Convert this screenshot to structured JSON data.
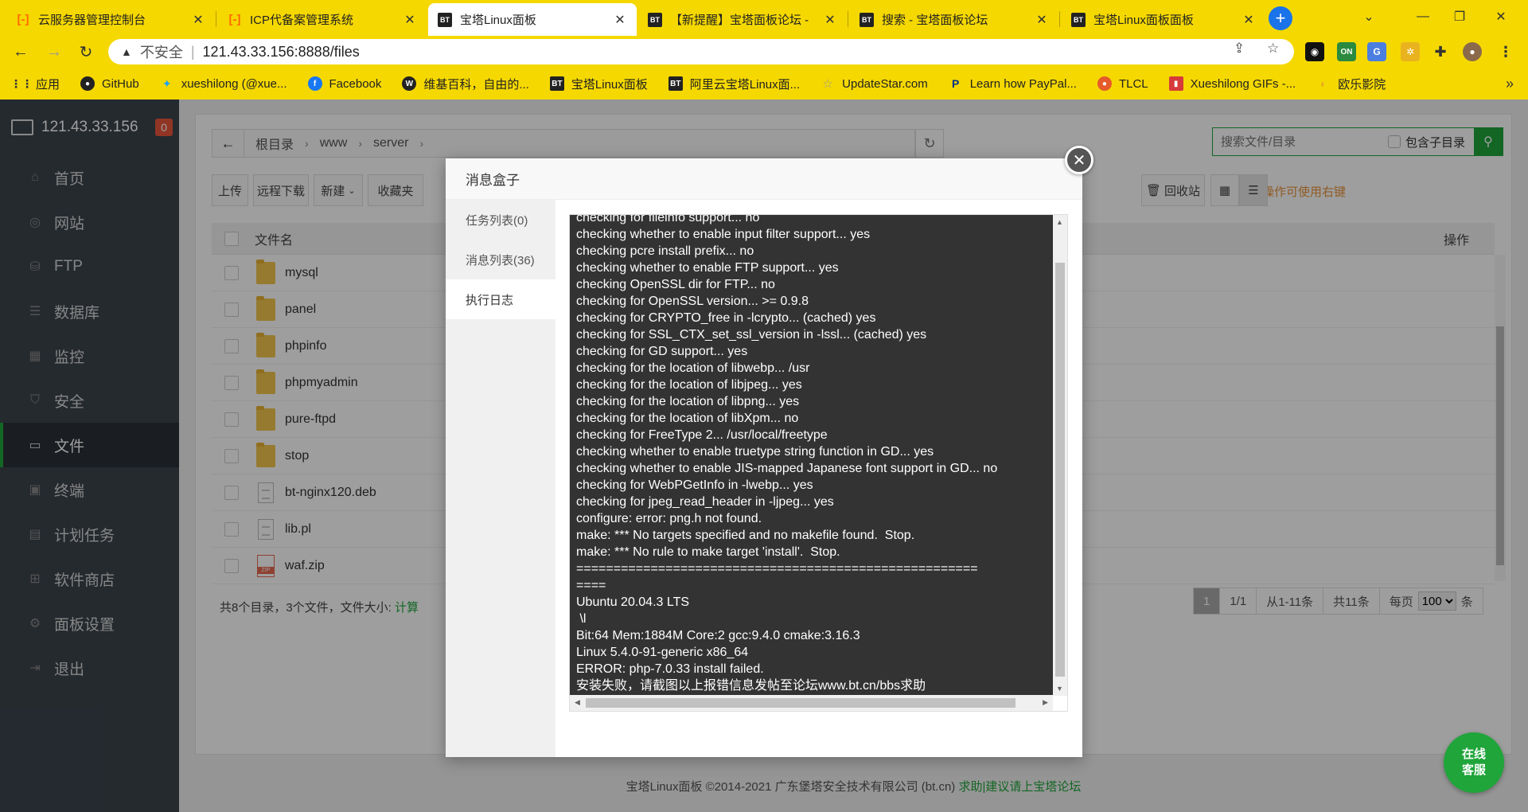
{
  "browser": {
    "tabs": [
      {
        "title": "云服务器管理控制台",
        "icon": "aliyun-icon"
      },
      {
        "title": "ICP代备案管理系统",
        "icon": "aliyun-icon"
      },
      {
        "title": "宝塔Linux面板",
        "icon": "bt-icon"
      },
      {
        "title": "【新提醒】宝塔面板论坛 -",
        "icon": "bt-icon"
      },
      {
        "title": "搜索 - 宝塔面板论坛",
        "icon": "bt-icon"
      },
      {
        "title": "宝塔Linux面板面板",
        "icon": "bt-icon"
      }
    ],
    "address": {
      "warning": "不安全",
      "url": "121.43.33.156:8888/files"
    },
    "bookmarks": [
      {
        "label": "应用"
      },
      {
        "label": "GitHub"
      },
      {
        "label": "xueshilong (@xue..."
      },
      {
        "label": "Facebook"
      },
      {
        "label": "维基百科，自由的..."
      },
      {
        "label": "宝塔Linux面板"
      },
      {
        "label": "阿里云宝塔Linux面..."
      },
      {
        "label": "UpdateStar.com"
      },
      {
        "label": "Learn how PayPal..."
      },
      {
        "label": "TLCL"
      },
      {
        "label": "Xueshilong GIFs -..."
      },
      {
        "label": "欧乐影院"
      }
    ],
    "ext_on_label": "ON"
  },
  "sidebar": {
    "server_ip": "121.43.33.156",
    "badge": "0",
    "items": [
      {
        "label": "首页"
      },
      {
        "label": "网站"
      },
      {
        "label": "FTP"
      },
      {
        "label": "数据库"
      },
      {
        "label": "监控"
      },
      {
        "label": "安全"
      },
      {
        "label": "文件"
      },
      {
        "label": "终端"
      },
      {
        "label": "计划任务"
      },
      {
        "label": "软件商店"
      },
      {
        "label": "面板设置"
      },
      {
        "label": "退出"
      }
    ]
  },
  "files": {
    "breadcrumb": [
      "根目录",
      "www",
      "server"
    ],
    "search_placeholder": "搜索文件/目录",
    "include_subdir": "包含子目录",
    "toolbar": {
      "upload": "上传",
      "remote_download": "远程下载",
      "new": "新建",
      "favorites": "收藏夹",
      "recycle": "回收站"
    },
    "tip": "文件操作可使用右键",
    "col_name": "文件名",
    "col_op": "操作",
    "rows": [
      {
        "name": "mysql",
        "type": "folder"
      },
      {
        "name": "panel",
        "type": "folder"
      },
      {
        "name": "phpinfo",
        "type": "folder"
      },
      {
        "name": "phpmyadmin",
        "type": "folder"
      },
      {
        "name": "pure-ftpd",
        "type": "folder"
      },
      {
        "name": "stop",
        "type": "folder"
      },
      {
        "name": "bt-nginx120.deb",
        "type": "file"
      },
      {
        "name": "lib.pl",
        "type": "file"
      },
      {
        "name": "waf.zip",
        "type": "zip"
      }
    ],
    "summary": "共8个目录，3个文件，文件大小:",
    "calc": "计算",
    "pager": {
      "current": "1",
      "pages": "1/1",
      "range": "从1-11条",
      "total": "共11条",
      "per_page_label": "每页",
      "per_page": "100",
      "unit": "条"
    }
  },
  "footer": {
    "copyright": "宝塔Linux面板 ©2014-2021 广东堡塔安全技术有限公司 (bt.cn)",
    "help": "求助|建议请上宝塔论坛"
  },
  "chat": {
    "line1": "在线",
    "line2": "客服"
  },
  "modal": {
    "title": "消息盒子",
    "nav": [
      {
        "label": "任务列表(0)"
      },
      {
        "label": "消息列表(36)"
      },
      {
        "label": "执行日志"
      }
    ],
    "log_lines": [
      "checking for fileinfo support... no",
      "checking whether to enable input filter support... yes",
      "checking pcre install prefix... no",
      "checking whether to enable FTP support... yes",
      "checking OpenSSL dir for FTP... no",
      "checking for OpenSSL version... >= 0.9.8",
      "checking for CRYPTO_free in -lcrypto... (cached) yes",
      "checking for SSL_CTX_set_ssl_version in -lssl... (cached) yes",
      "checking for GD support... yes",
      "checking for the location of libwebp... /usr",
      "checking for the location of libjpeg... yes",
      "checking for the location of libpng... yes",
      "checking for the location of libXpm... no",
      "checking for FreeType 2... /usr/local/freetype",
      "checking whether to enable truetype string function in GD... yes",
      "checking whether to enable JIS-mapped Japanese font support in GD... no",
      "checking for WebPGetInfo in -lwebp... yes",
      "checking for jpeg_read_header in -ljpeg... yes",
      "configure: error: png.h not found.",
      "make: *** No targets specified and no makefile found.  Stop.",
      "make: *** No rule to make target 'install'.  Stop.",
      "======================================================",
      "====",
      "Ubuntu 20.04.3 LTS",
      " \\l",
      "Bit:64 Mem:1884M Core:2 gcc:9.4.0 cmake:3.16.3",
      "Linux 5.4.0-91-generic x86_64",
      "ERROR: php-7.0.33 install failed.",
      "安装失败，请截图以上报错信息发帖至论坛www.bt.cn/bbs求助"
    ]
  }
}
